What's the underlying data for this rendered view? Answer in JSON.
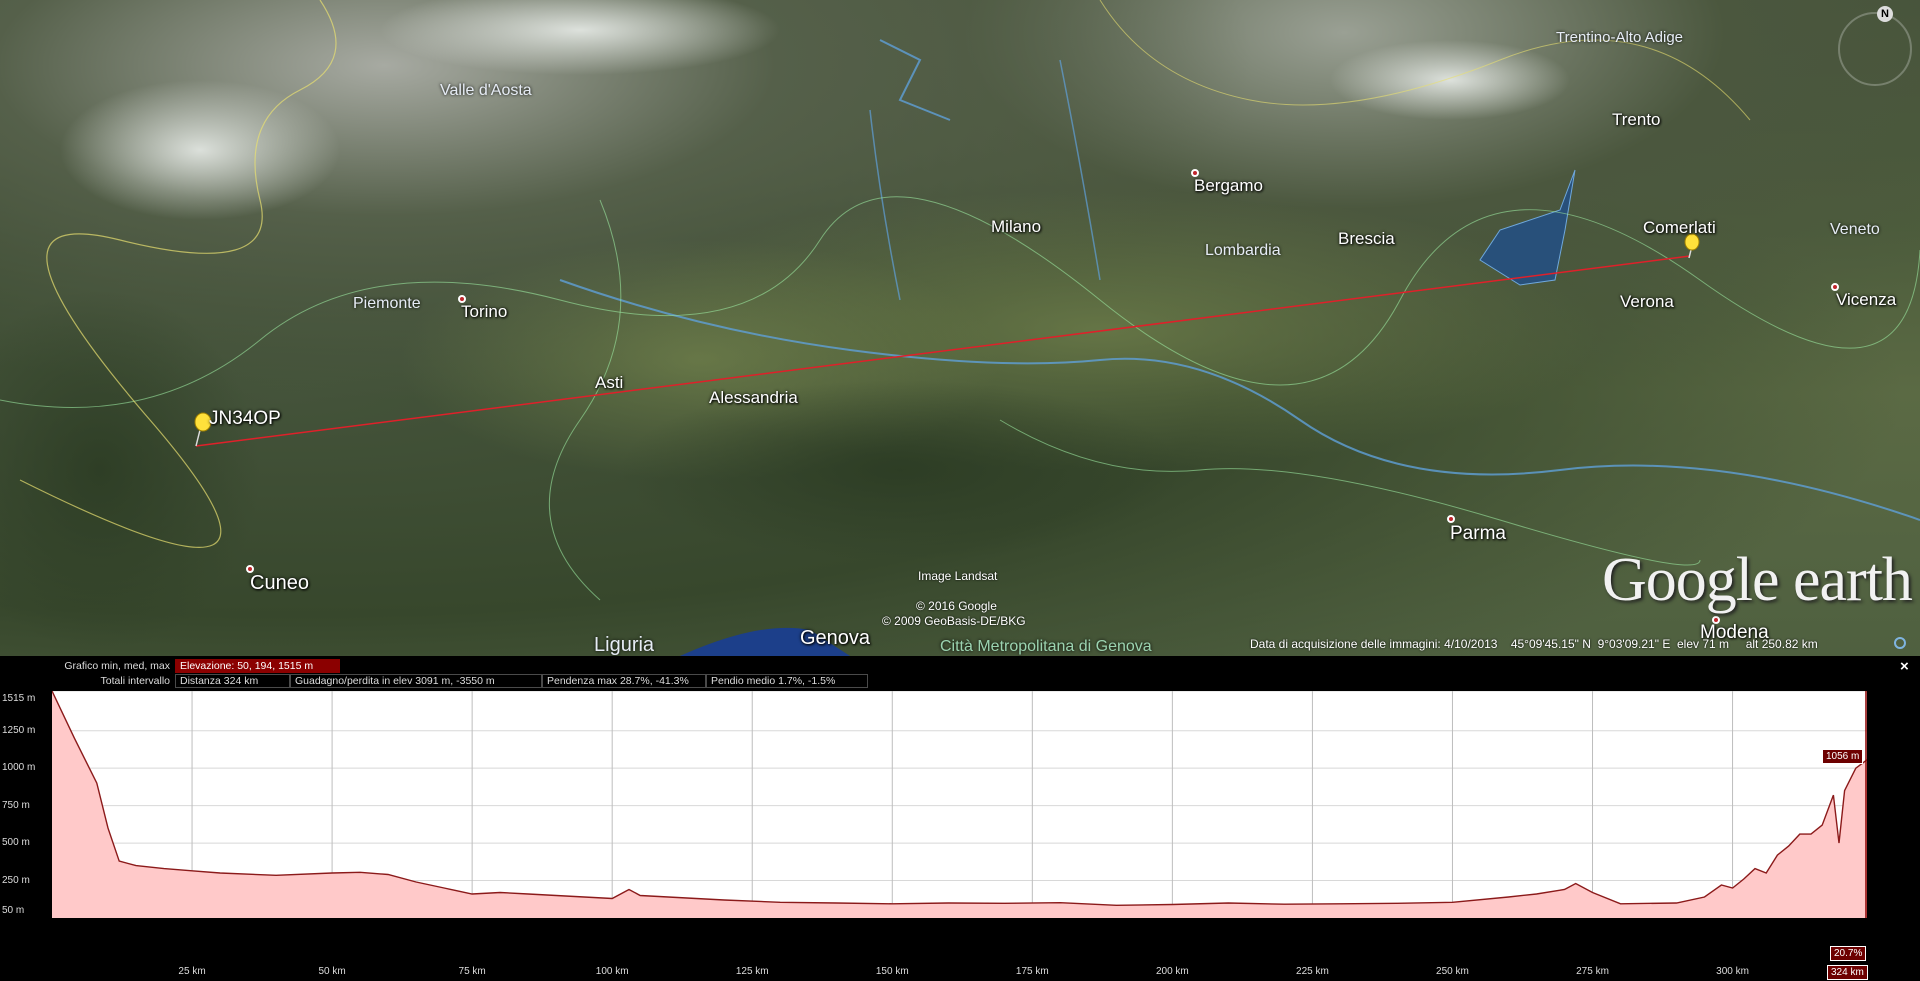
{
  "map": {
    "regions": [
      "Valle d'Aosta",
      "Piemonte",
      "Lombardia",
      "Trentino-Alto Adige",
      "Veneto",
      "Liguria",
      "Città Metropolitana di Genova"
    ],
    "cities": [
      "Torino",
      "Asti",
      "Alessandria",
      "Milano",
      "Bergamo",
      "Brescia",
      "Trento",
      "Verona",
      "Vicenza",
      "Parma",
      "Modena",
      "Cuneo",
      "Genova"
    ],
    "placemarks": [
      "JN34OP",
      "Comerlati"
    ],
    "credits": [
      "Image Landsat",
      "© 2016 Google",
      "© 2009 GeoBasis-DE/BKG"
    ],
    "logo": "Google earth",
    "compass_north": "N",
    "status_bar": {
      "imagery_date": "Data di acquisizione delle immagini: 4/10/2013",
      "lat": "45°09'45.15\" N",
      "lon": "9°03'09.21\" E",
      "elev": "elev   71 m",
      "eye_alt": "alt 250.82 km"
    },
    "path_color": "#e0202a"
  },
  "profile": {
    "close_label": "×",
    "row1_label": "Grafico  min, med, max",
    "row1_value": "Elevazione: 50, 194, 1515 m",
    "row2_label": "Totali intervallo",
    "row2_items": [
      "Distanza  324 km",
      "Guadagno/perdita in elev   3091 m, -3550 m",
      "Pendenza max  28.7%, -41.3%",
      "Pendio medio  1.7%, -1.5%"
    ],
    "cursor_elevation": "1056 m",
    "cursor_slope": "20.7%",
    "cursor_distance": "324 km",
    "fill_color": "#ffc9c9",
    "line_color": "#8b1a1a"
  },
  "chart_data": {
    "type": "area",
    "title": "",
    "xlabel": "",
    "ylabel": "",
    "xlim": [
      0,
      324
    ],
    "ylim": [
      0,
      1515
    ],
    "y_ticks": [
      {
        "label": "1515 m",
        "value": 1515
      },
      {
        "label": "1250 m",
        "value": 1250
      },
      {
        "label": "1000 m",
        "value": 1000
      },
      {
        "label": "750 m",
        "value": 750
      },
      {
        "label": "500 m",
        "value": 500
      },
      {
        "label": "250 m",
        "value": 250
      },
      {
        "label": "50 m",
        "value": 50
      }
    ],
    "x_ticks": [
      {
        "label": "25 km",
        "value": 25
      },
      {
        "label": "50 km",
        "value": 50
      },
      {
        "label": "75 km",
        "value": 75
      },
      {
        "label": "100 km",
        "value": 100
      },
      {
        "label": "125 km",
        "value": 125
      },
      {
        "label": "150 km",
        "value": 150
      },
      {
        "label": "175 km",
        "value": 175
      },
      {
        "label": "200 km",
        "value": 200
      },
      {
        "label": "225 km",
        "value": 225
      },
      {
        "label": "250 km",
        "value": 250
      },
      {
        "label": "275 km",
        "value": 275
      },
      {
        "label": "300 km",
        "value": 300
      }
    ],
    "x": [
      0,
      4,
      8,
      10,
      12,
      15,
      20,
      25,
      30,
      40,
      50,
      55,
      60,
      65,
      70,
      75,
      80,
      85,
      90,
      95,
      100,
      103,
      105,
      110,
      120,
      130,
      140,
      150,
      160,
      170,
      180,
      190,
      200,
      210,
      220,
      230,
      240,
      250,
      260,
      265,
      270,
      272,
      275,
      280,
      290,
      295,
      298,
      300,
      302,
      304,
      306,
      308,
      310,
      312,
      314,
      316,
      318,
      319,
      320,
      322,
      324
    ],
    "values": [
      1515,
      1200,
      900,
      600,
      380,
      350,
      330,
      315,
      300,
      285,
      300,
      305,
      290,
      240,
      200,
      160,
      170,
      160,
      150,
      140,
      130,
      190,
      150,
      140,
      120,
      105,
      100,
      95,
      100,
      98,
      102,
      85,
      90,
      100,
      92,
      95,
      98,
      105,
      140,
      160,
      190,
      230,
      170,
      95,
      100,
      140,
      220,
      200,
      260,
      330,
      300,
      420,
      480,
      560,
      560,
      620,
      820,
      500,
      850,
      1000,
      1056
    ]
  }
}
